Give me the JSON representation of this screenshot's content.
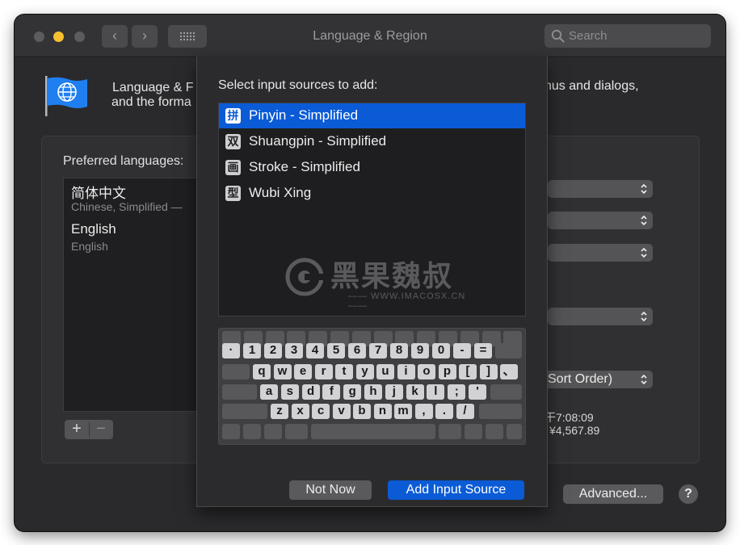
{
  "window": {
    "title": "Language & Region"
  },
  "titlebar": {
    "back_icon": "‹",
    "forward_icon": "›"
  },
  "search": {
    "placeholder": "Search"
  },
  "description": {
    "line1_left": "Language & F",
    "line2_left": "and the forma",
    "line1_right": "nus and dialogs,"
  },
  "preferred_languages": {
    "label": "Preferred languages:",
    "items": [
      {
        "name": "简体中文",
        "sub": "Chinese, Simplified —"
      },
      {
        "name": "English",
        "sub": "English"
      }
    ],
    "add_label": "+",
    "remove_label": "−"
  },
  "right_panel": {
    "sort_order_label": "Sort Order)",
    "time_sample": "干7:08:09",
    "currency_sample": "¥4,567.89"
  },
  "footer": {
    "advanced_label": "Advanced...",
    "help_label": "?"
  },
  "sheet": {
    "prompt": "Select input sources to add:",
    "sources": [
      {
        "icon": "拼",
        "label": "Pinyin - Simplified",
        "selected": true
      },
      {
        "icon": "双",
        "label": "Shuangpin - Simplified",
        "selected": false
      },
      {
        "icon": "画",
        "label": "Stroke - Simplified",
        "selected": false
      },
      {
        "icon": "型",
        "label": "Wubi Xing",
        "selected": false
      }
    ],
    "watermark": {
      "brand": "黑果魏叔",
      "url": "—— WWW.IMACOSX.CN ——"
    },
    "keyboard": {
      "row1": [
        "·",
        "1",
        "2",
        "3",
        "4",
        "5",
        "6",
        "7",
        "8",
        "9",
        "0",
        "-",
        "="
      ],
      "row2": [
        "q",
        "w",
        "e",
        "r",
        "t",
        "y",
        "u",
        "i",
        "o",
        "p",
        "[",
        "]",
        "、"
      ],
      "row3": [
        "a",
        "s",
        "d",
        "f",
        "g",
        "h",
        "j",
        "k",
        "l",
        ";",
        "'"
      ],
      "row4": [
        "z",
        "x",
        "c",
        "v",
        "b",
        "n",
        "m",
        ",",
        ".",
        "/"
      ]
    },
    "not_now_label": "Not Now",
    "add_label": "Add Input Source"
  },
  "colors": {
    "accent": "#0b5bd6",
    "window_bg": "#2a2a2c",
    "yellow_light": "#f5bf30"
  }
}
